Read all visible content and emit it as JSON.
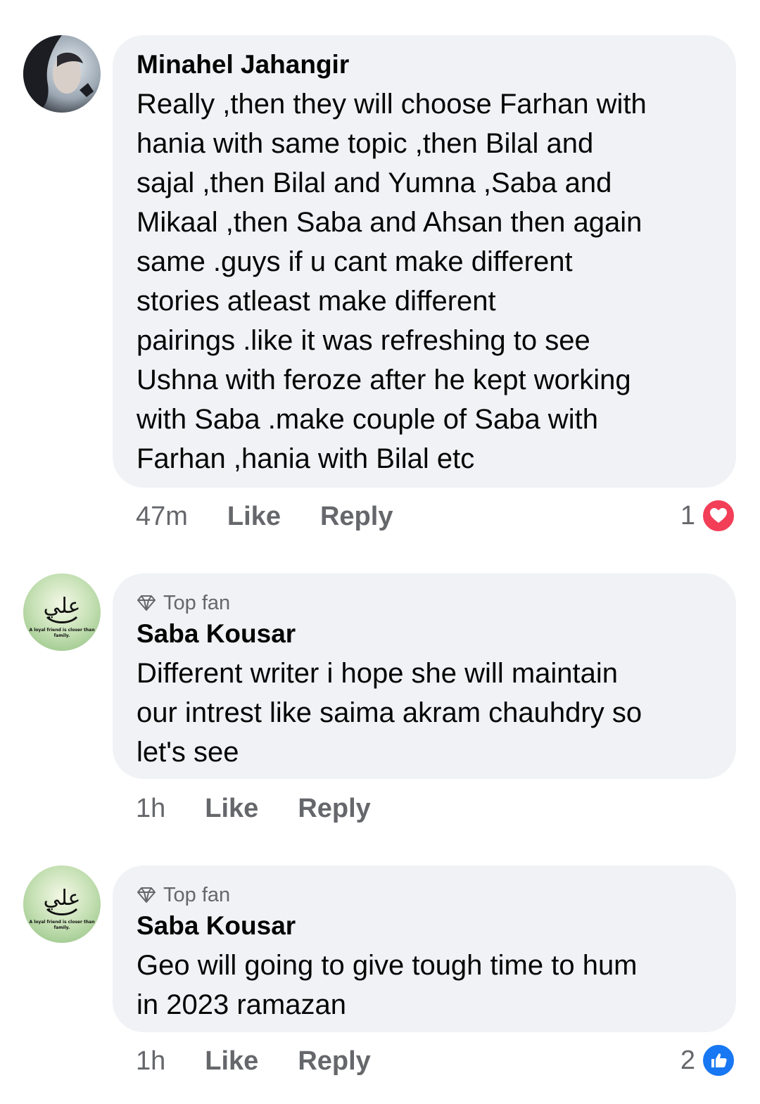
{
  "comments": [
    {
      "author": "Minahel Jahangir",
      "badge": "",
      "text": "Really ,then they will choose Farhan with\nhania with same topic ,then Bilal and\nsajal ,then Bilal and Yumna ,Saba and\nMikaal ,then Saba and Ahsan then again\nsame .guys if u cant make different\nstories atleast make different\npairings .like it was refreshing to see\nUshna with feroze after he kept working\nwith Saba .make couple of Saba with\nFarhan ,hania with Bilal etc",
      "time": "47m",
      "like_label": "Like",
      "reply_label": "Reply",
      "reaction_count": "1",
      "reaction_icon": "love-icon",
      "reaction_color": "#f33e58"
    },
    {
      "author": "Saba Kousar",
      "badge": "Top fan",
      "avatar_caption": "A loyal friend is closer than family.",
      "text": "Different writer i hope she will maintain\nour intrest like saima akram chauhdry so\nlet's see",
      "time": "1h",
      "like_label": "Like",
      "reply_label": "Reply",
      "reaction_count": "",
      "reaction_icon": ""
    },
    {
      "author": "Saba Kousar",
      "badge": "Top fan",
      "avatar_caption": "A loyal friend is closer than family.",
      "text": "Geo will going to give tough time to hum\nin 2023 ramazan",
      "time": "1h",
      "like_label": "Like",
      "reply_label": "Reply",
      "reaction_count": "2",
      "reaction_icon": "like-icon",
      "reaction_color": "#1877f2"
    }
  ],
  "colors": {
    "bubble": "#f0f2f5",
    "secondary_text": "#65676b",
    "primary_text": "#050505"
  }
}
